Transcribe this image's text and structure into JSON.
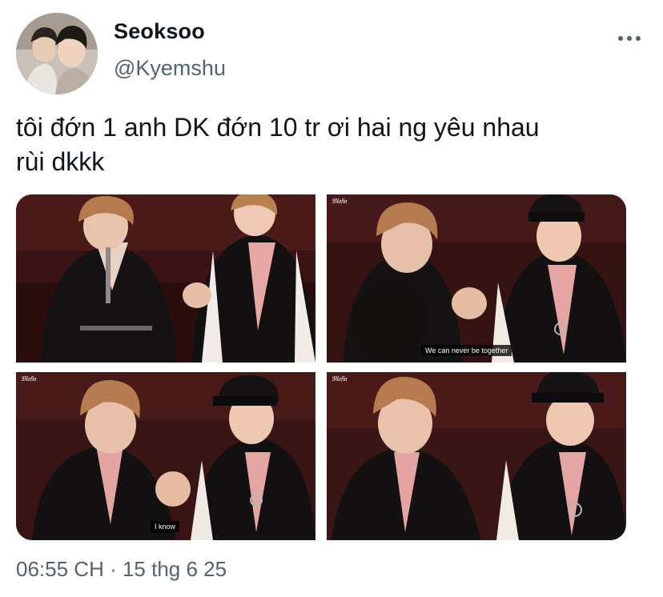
{
  "user": {
    "display_name": "Seoksoo",
    "handle": "@Kyemshu"
  },
  "tweet": {
    "text": "tôi đớn 1 anh DK đớn 10 tr ơi hai ng yêu nhau\nrùi dkkk",
    "timestamp": "06:55 CH · 15 thg 6 25"
  },
  "media": [
    {
      "subtitle": "",
      "watermark": ""
    },
    {
      "subtitle": "We can never be together",
      "watermark": "𝔐𝔞𝔣𝔦𝔞"
    },
    {
      "subtitle": "I know",
      "watermark": "𝔐𝔞𝔣𝔦𝔞"
    },
    {
      "subtitle": "",
      "watermark": "𝔐𝔞𝔣𝔦𝔞"
    }
  ],
  "colors": {
    "text_primary": "#0f1419",
    "text_secondary": "#536471",
    "scene_bg": "#3a1414"
  },
  "icons": {
    "more": "more-horizontal-icon"
  }
}
